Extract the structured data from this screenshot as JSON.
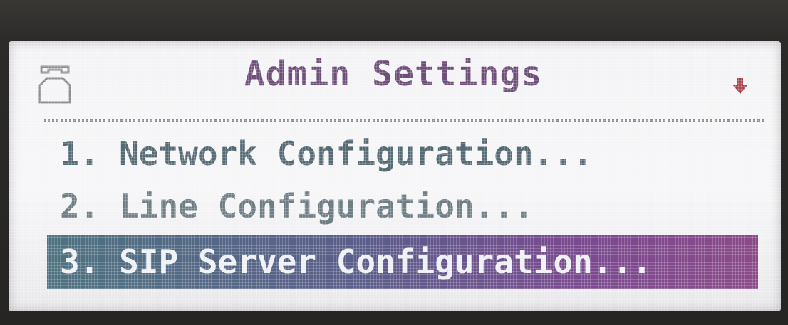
{
  "header": {
    "title": "Admin Settings",
    "left_icon": "phone-handset-icon",
    "right_icon": "scroll-down-arrow-icon"
  },
  "menu": {
    "items": [
      {
        "label": "1. Network Configuration..."
      },
      {
        "label": "2. Line Configuration..."
      },
      {
        "label": "3. SIP Server Configuration..."
      }
    ],
    "selected_index": 2
  },
  "colors": {
    "title": "#6e4f79",
    "item_text": "#566a74",
    "selection_start": "#4e7280",
    "selection_end": "#8a4a88",
    "arrow": "#a8454d"
  }
}
